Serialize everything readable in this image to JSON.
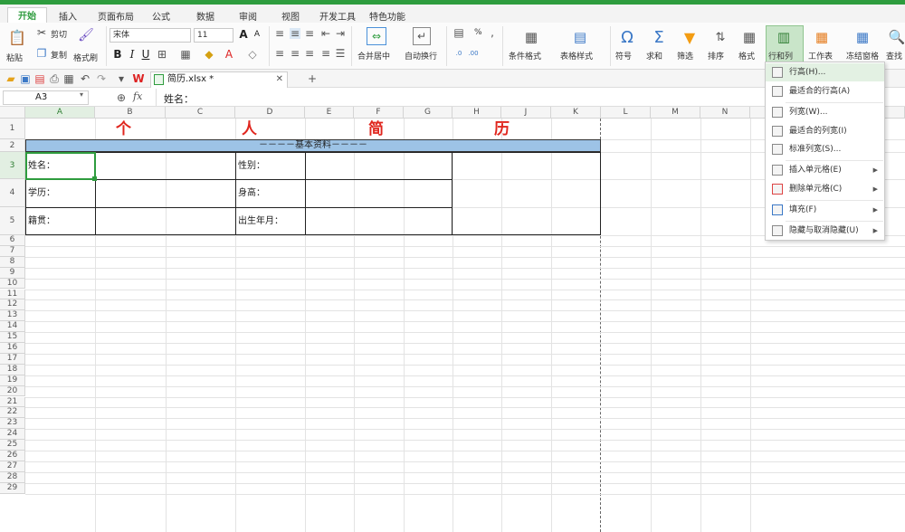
{
  "tabs": [
    "开始",
    "插入",
    "页面布局",
    "公式",
    "数据",
    "审阅",
    "视图",
    "开发工具",
    "特色功能"
  ],
  "ribbon": {
    "paste": "粘贴",
    "cut": "剪切",
    "copy": "复制",
    "format_painter": "格式刷",
    "font_name": "宋体",
    "font_size": "11",
    "merge_center": "合并居中",
    "wrap_text": "自动换行",
    "conditional_format": "条件格式",
    "table_style": "表格样式",
    "symbol": "符号",
    "sum": "求和",
    "filter": "筛选",
    "sort": "排序",
    "format": "格式",
    "row_col": "行和列",
    "worksheet": "工作表",
    "freeze": "冻结窗格",
    "find": "查找",
    "percent": "%"
  },
  "doc": {
    "filename": "简历.xlsx *"
  },
  "formula": {
    "name_box": "A3",
    "fx": "fx",
    "content": "姓名："
  },
  "columns": [
    "A",
    "B",
    "C",
    "D",
    "E",
    "F",
    "G",
    "H",
    "I",
    "J",
    "K",
    "L",
    "M",
    "N"
  ],
  "rows": [
    "1",
    "2",
    "3",
    "4",
    "5",
    "6",
    "7",
    "8",
    "9",
    "10",
    "11",
    "12",
    "13",
    "14",
    "15",
    "16",
    "17",
    "18",
    "19",
    "20",
    "21",
    "22",
    "23",
    "24",
    "25",
    "26",
    "27",
    "28",
    "29"
  ],
  "sheet": {
    "title_chars": [
      "个",
      "人",
      "简",
      "历"
    ],
    "section_header": "－－－－基本资料－－－－",
    "name_label": "姓名：",
    "gender_label": "性别：",
    "education_label": "学历：",
    "height_label": "身高：",
    "hometown_label": "籍贯：",
    "birth_label": "出生年月："
  },
  "menu": {
    "items": [
      "行高(H)...",
      "最适合的行高(A)",
      "列宽(W)...",
      "最适合的列宽(I)",
      "标准列宽(S)...",
      "插入单元格(E)",
      "删除单元格(C)",
      "填充(F)",
      "隐藏与取消隐藏(U)"
    ]
  },
  "colors": {
    "accent": "#2e9c3e",
    "title_red": "#e0261e",
    "header_blue": "#9dc3e6"
  }
}
